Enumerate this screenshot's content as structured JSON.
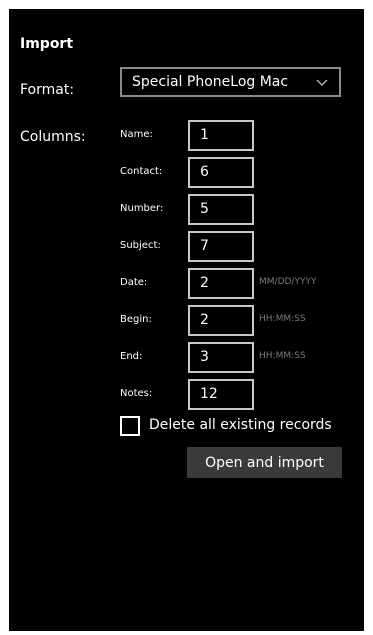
{
  "title": "Import",
  "format": {
    "label": "Format:",
    "selected": "Special PhoneLog Mac"
  },
  "columns": {
    "label": "Columns:",
    "fields": [
      {
        "name": "Name:",
        "value": "1",
        "hint": ""
      },
      {
        "name": "Contact:",
        "value": "6",
        "hint": ""
      },
      {
        "name": "Number:",
        "value": "5",
        "hint": ""
      },
      {
        "name": "Subject:",
        "value": "7",
        "hint": ""
      },
      {
        "name": "Date:",
        "value": "2",
        "hint": "MM/DD/YYYY"
      },
      {
        "name": "Begin:",
        "value": "2",
        "hint": "HH:MM:SS"
      },
      {
        "name": "End:",
        "value": "3",
        "hint": "HH:MM:SS"
      },
      {
        "name": "Notes:",
        "value": "12",
        "hint": ""
      }
    ]
  },
  "delete_records": {
    "label": "Delete all existing records",
    "checked": false
  },
  "open_import_label": "Open and import",
  "icons": {
    "select_chevron": "chevron-down-icon"
  }
}
